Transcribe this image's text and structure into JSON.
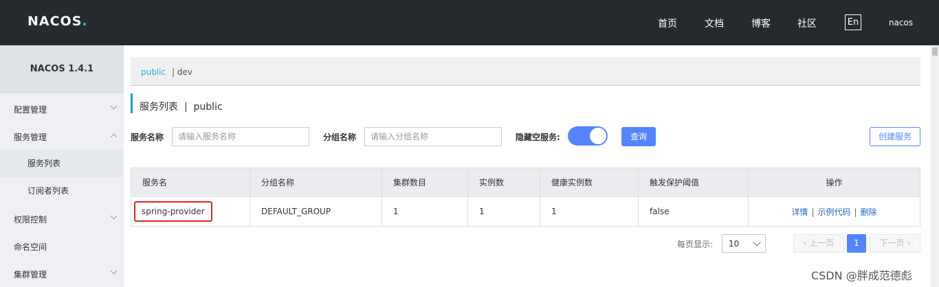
{
  "header": {
    "logo": "NACOS",
    "logo_dot": ".",
    "nav": [
      "首页",
      "文档",
      "博客",
      "社区"
    ],
    "lang": "En",
    "user": "nacos"
  },
  "sidebar": {
    "version": "NACOS 1.4.1",
    "items": [
      {
        "label": "配置管理",
        "expanded": false
      },
      {
        "label": "服务管理",
        "expanded": true
      },
      {
        "label": "服务列表"
      },
      {
        "label": "订阅者列表"
      },
      {
        "label": "权限控制",
        "expanded": false
      },
      {
        "label": "命名空间"
      },
      {
        "label": "集群管理",
        "expanded": false
      }
    ]
  },
  "namespace": {
    "active": "public",
    "sep": "|",
    "other": "dev"
  },
  "page": {
    "title": "服务列表",
    "title_sep": "|",
    "title_ns": "public"
  },
  "filters": {
    "service_label": "服务名称",
    "service_placeholder": "请输入服务名称",
    "group_label": "分组名称",
    "group_placeholder": "请输入分组名称",
    "hide_empty_label": "隐藏空服务:",
    "hide_empty_on": true,
    "query_button": "查询",
    "create_button": "创建服务"
  },
  "table": {
    "columns": [
      "服务名",
      "分组名称",
      "集群数目",
      "实例数",
      "健康实例数",
      "触发保护阈值",
      "操作"
    ],
    "rows": [
      {
        "service": "spring-provider",
        "group": "DEFAULT_GROUP",
        "clusters": "1",
        "instances": "1",
        "healthy": "1",
        "threshold": "false",
        "actions": [
          "详情",
          "示例代码",
          "删除"
        ]
      }
    ],
    "action_sep": "|"
  },
  "pagination": {
    "page_size_label": "每页显示:",
    "page_size": "10",
    "prev": "上一页",
    "current": "1",
    "next": "下一页"
  },
  "watermark": "CSDN @胖成范德彪",
  "colors": {
    "header_bg": "#252a2f",
    "primary": "#5584ff",
    "link": "#2266cc",
    "highlight_border": "#e2231a"
  }
}
